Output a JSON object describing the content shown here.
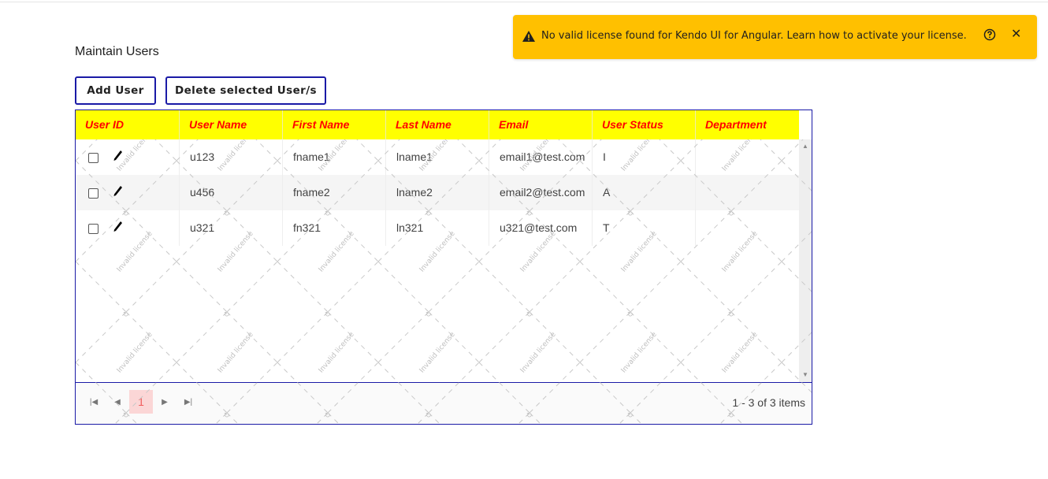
{
  "page": {
    "title": "Maintain Users"
  },
  "toolbar": {
    "add_label": "Add User",
    "delete_label": "Delete selected User/s"
  },
  "grid": {
    "columns": [
      "User ID",
      "User Name",
      "First Name",
      "Last Name",
      "Email",
      "User Status",
      "Department"
    ],
    "rows": [
      {
        "user_name": "u123",
        "first_name": "fname1",
        "last_name": "lname1",
        "email": "email1@test.com",
        "status": "I",
        "department": ""
      },
      {
        "user_name": "u456",
        "first_name": "fname2",
        "last_name": "lname2",
        "email": "email2@test.com",
        "status": "A",
        "department": ""
      },
      {
        "user_name": "u321",
        "first_name": "fn321",
        "last_name": "ln321",
        "email": "u321@test.com",
        "status": "T",
        "department": ""
      }
    ],
    "colors": {
      "header_bg": "#ffff00",
      "header_text": "#ff0000",
      "border": "#1a1aa6"
    }
  },
  "pager": {
    "current_page": "1",
    "info": "1 - 3 of 3 items"
  },
  "watermark": {
    "text": "Invalid license"
  },
  "notification": {
    "message": "No valid license found for Kendo UI for Angular. Learn how to activate your license.",
    "bg_color": "#ffc000",
    "icons": [
      "warning-icon",
      "help-icon",
      "close-icon"
    ]
  }
}
